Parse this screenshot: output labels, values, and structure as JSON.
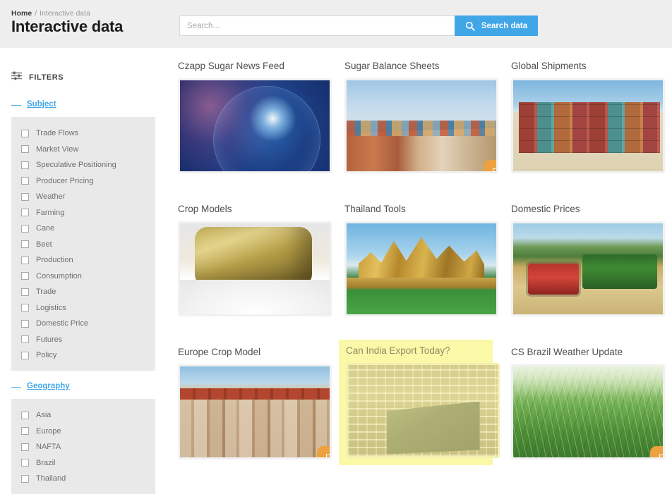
{
  "header": {
    "breadcrumb": {
      "home": "Home",
      "separator": "/",
      "current": "Interactive data"
    },
    "title": "Interactive data",
    "search": {
      "placeholder": "Search...",
      "value": "",
      "button_label": "Search data"
    },
    "accent_color": "#41a6e8",
    "background_color": "#eeeeee"
  },
  "sidebar": {
    "filters_label": "FILTERS",
    "groups": [
      {
        "name": "Subject",
        "collapse_symbol": "—",
        "expanded": true,
        "options": [
          {
            "label": "Trade Flows",
            "checked": false
          },
          {
            "label": "Market View",
            "checked": false
          },
          {
            "label": "Speculative Positioning",
            "checked": false
          },
          {
            "label": "Producer Pricing",
            "checked": false
          },
          {
            "label": "Weather",
            "checked": false
          },
          {
            "label": "Farming",
            "checked": false
          },
          {
            "label": "Cane",
            "checked": false
          },
          {
            "label": "Beet",
            "checked": false
          },
          {
            "label": "Production",
            "checked": false
          },
          {
            "label": "Consumption",
            "checked": false
          },
          {
            "label": "Trade",
            "checked": false
          },
          {
            "label": "Logistics",
            "checked": false
          },
          {
            "label": "Domestic Price",
            "checked": false
          },
          {
            "label": "Futures",
            "checked": false
          },
          {
            "label": "Policy",
            "checked": false
          }
        ]
      },
      {
        "name": "Geography",
        "collapse_symbol": "—",
        "expanded": true,
        "options": [
          {
            "label": "Asia",
            "checked": false
          },
          {
            "label": "Europe",
            "checked": false
          },
          {
            "label": "NAFTA",
            "checked": false
          },
          {
            "label": "Brazil",
            "checked": false
          },
          {
            "label": "Thailand",
            "checked": false
          }
        ]
      }
    ]
  },
  "grid": {
    "badge_label": "P",
    "badge_color": "#eda140",
    "highlight_color": "#fbf8a8",
    "cards": [
      {
        "title": "Czapp Sugar News Feed",
        "image": "globe-network-photo",
        "badge": false,
        "highlighted": false
      },
      {
        "title": "Sugar Balance Sheets",
        "image": "container-ship-ocean-photo",
        "badge": true,
        "highlighted": false
      },
      {
        "title": "Global Shipments",
        "image": "stacked-shipping-containers-photo",
        "badge": false,
        "highlighted": false
      },
      {
        "title": "Crop Models",
        "image": "sugar-cane-cut-photo",
        "badge": false,
        "highlighted": false
      },
      {
        "title": "Thailand Tools",
        "image": "thai-temple-photo",
        "badge": false,
        "highlighted": false
      },
      {
        "title": "Domestic Prices",
        "image": "cane-harvester-tractor-photo",
        "badge": false,
        "highlighted": false
      },
      {
        "title": "Europe Crop Model",
        "image": "european-town-rooftops-photo",
        "badge": true,
        "highlighted": false
      },
      {
        "title": "Can India Export Today?",
        "image": "sugar-sacks-warehouse-photo",
        "badge": false,
        "highlighted": true
      },
      {
        "title": "CS Brazil Weather Update",
        "image": "sugarcane-field-closeup-photo",
        "badge": true,
        "highlighted": false
      }
    ]
  }
}
